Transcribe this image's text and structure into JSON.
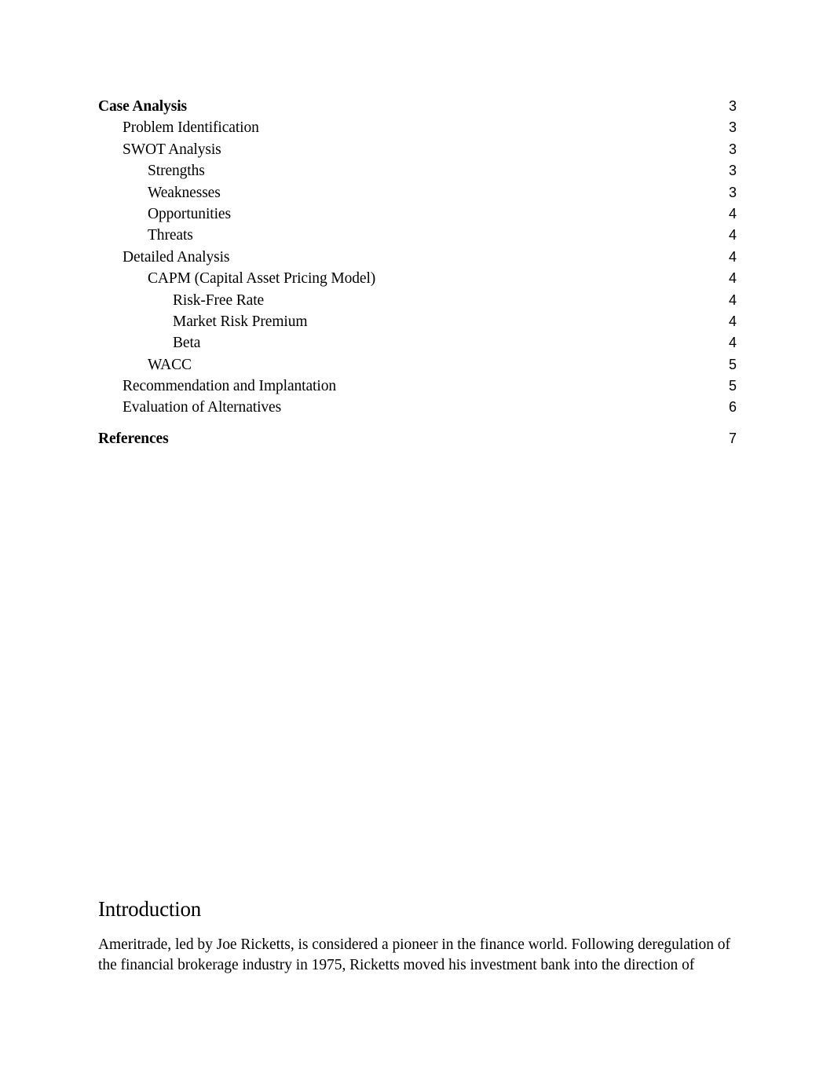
{
  "document": {
    "page_background": "#ffffff",
    "text_color": "#000000"
  },
  "toc": {
    "entries": [
      {
        "label": "Case Analysis",
        "page": "3",
        "level": 1,
        "bold": true,
        "gap_before": false
      },
      {
        "label": "Problem Identification",
        "page": "3",
        "level": 2,
        "bold": false,
        "gap_before": false
      },
      {
        "label": "SWOT Analysis",
        "page": "3",
        "level": 2,
        "bold": false,
        "gap_before": false
      },
      {
        "label": "Strengths",
        "page": "3",
        "level": 3,
        "bold": false,
        "gap_before": false
      },
      {
        "label": "Weaknesses",
        "page": "3",
        "level": 3,
        "bold": false,
        "gap_before": false
      },
      {
        "label": "Opportunities",
        "page": "4",
        "level": 3,
        "bold": false,
        "gap_before": false
      },
      {
        "label": "Threats",
        "page": "4",
        "level": 3,
        "bold": false,
        "gap_before": false
      },
      {
        "label": "Detailed Analysis",
        "page": "4",
        "level": 2,
        "bold": false,
        "gap_before": false
      },
      {
        "label": "CAPM (Capital Asset Pricing Model)",
        "page": "4",
        "level": 3,
        "bold": false,
        "gap_before": false
      },
      {
        "label": "Risk-Free Rate",
        "page": "4",
        "level": 4,
        "bold": false,
        "gap_before": false
      },
      {
        "label": "Market Risk Premium",
        "page": "4",
        "level": 4,
        "bold": false,
        "gap_before": false
      },
      {
        "label": "Beta",
        "page": "4",
        "level": 4,
        "bold": false,
        "gap_before": false
      },
      {
        "label": "WACC",
        "page": "5",
        "level": 3,
        "bold": false,
        "gap_before": false
      },
      {
        "label": "Recommendation and Implantation",
        "page": "5",
        "level": 2,
        "bold": false,
        "gap_before": false
      },
      {
        "label": "Evaluation of Alternatives",
        "page": "6",
        "level": 2,
        "bold": false,
        "gap_before": false
      },
      {
        "label": "References",
        "page": "7",
        "level": 1,
        "bold": true,
        "gap_before": true
      }
    ]
  },
  "introduction": {
    "heading": "Introduction",
    "paragraph": "Ameritrade, led by Joe Ricketts, is considered a pioneer in the finance world.  Following deregulation of the financial brokerage industry in 1975, Ricketts moved his investment bank into the direction of"
  }
}
